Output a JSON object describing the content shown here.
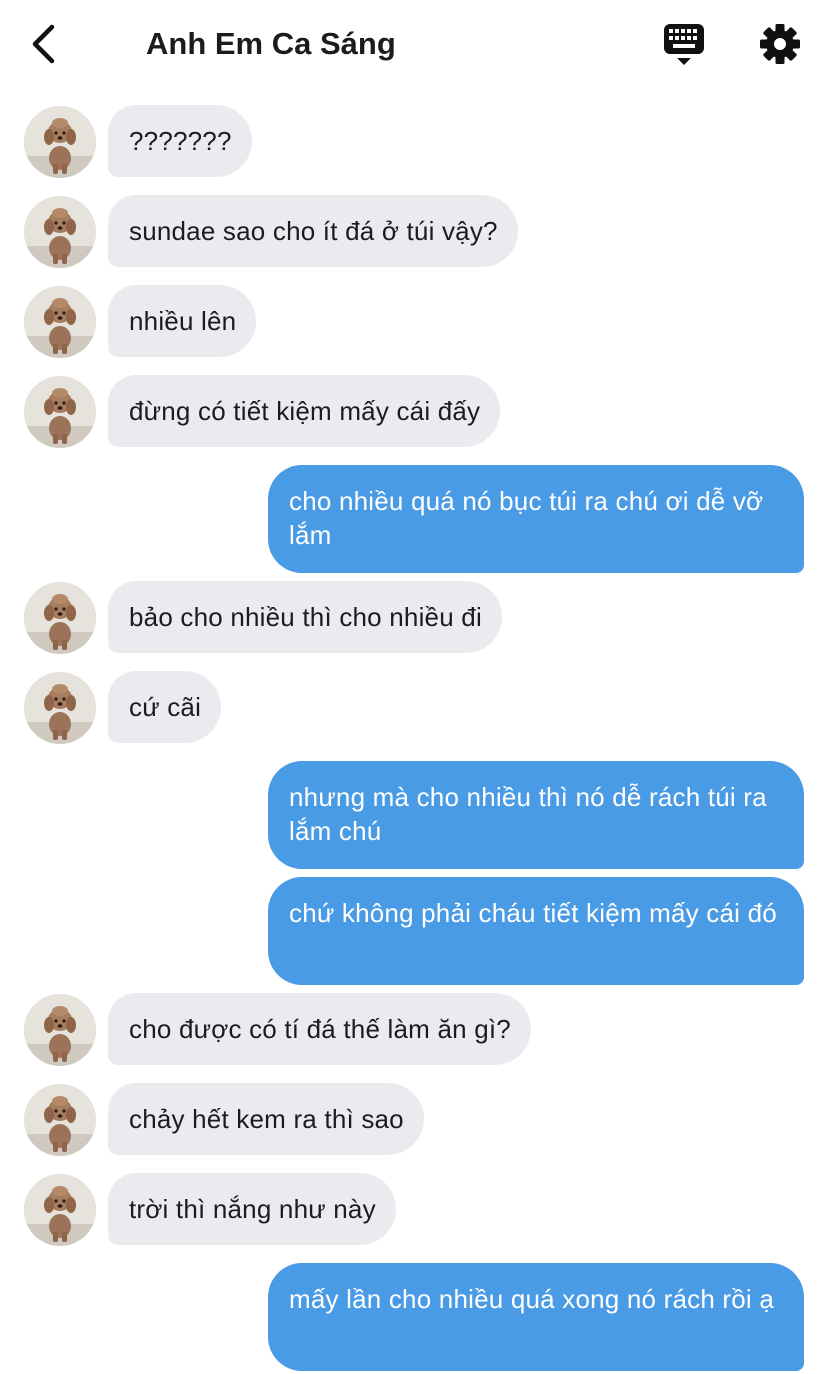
{
  "header": {
    "title": "Anh Em Ca Sáng",
    "back_icon": "chevron-left-icon",
    "keyboard_icon": "keyboard-icon",
    "settings_icon": "gear-icon"
  },
  "colors": {
    "incoming_bubble": "#e9ebef",
    "outgoing_bubble": "#4a9be6",
    "title_text": "#1c1c1e"
  },
  "messages": [
    {
      "from": "them",
      "text": "???????"
    },
    {
      "from": "them",
      "text": "sundae sao cho ít đá ở túi vậy?"
    },
    {
      "from": "them",
      "text": "nhiều lên"
    },
    {
      "from": "them",
      "text": "đừng có tiết kiệm mấy cái đấy"
    },
    {
      "from": "me",
      "text": "cho nhiều quá nó bục túi ra chú ơi dễ vỡ lắm"
    },
    {
      "from": "them",
      "text": "bảo cho nhiều thì cho nhiều đi"
    },
    {
      "from": "them",
      "text": "cứ cãi"
    },
    {
      "from": "me",
      "text": "nhưng mà cho nhiều thì nó dễ rách túi ra lắm chú"
    },
    {
      "from": "me",
      "text": "chứ không phải cháu tiết kiệm mấy cái đó"
    },
    {
      "from": "them",
      "text": "cho được có tí đá thế làm ăn gì?"
    },
    {
      "from": "them",
      "text": "chảy hết kem ra thì sao"
    },
    {
      "from": "them",
      "text": "trời thì nắng như này"
    },
    {
      "from": "me",
      "text": "mấy lần cho nhiều quá xong nó rách rồi ạ"
    }
  ]
}
